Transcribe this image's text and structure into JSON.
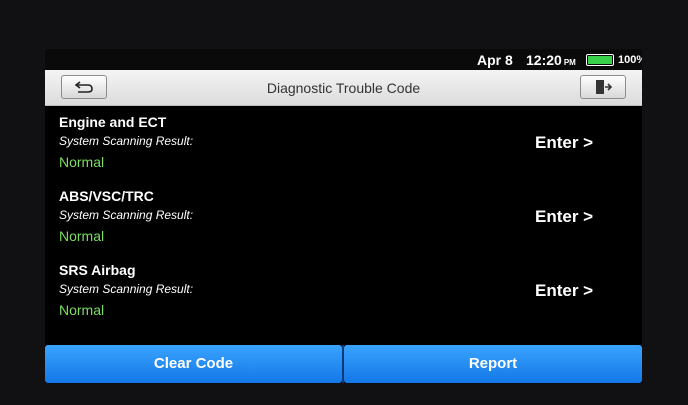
{
  "status": {
    "date": "Apr 8",
    "time": "12:20",
    "ampm": "PM",
    "battery_percent": "100%",
    "battery_level": 1.0,
    "battery_color": "#39d04a"
  },
  "header": {
    "title": "Diagnostic Trouble Code",
    "back_icon": "back-arrow-icon",
    "exit_icon": "exit-door-icon"
  },
  "systems": [
    {
      "name": "Engine and ECT",
      "result_label": "System Scanning Result:",
      "result": "Normal",
      "action": "Enter >"
    },
    {
      "name": "ABS/VSC/TRC",
      "result_label": "System Scanning Result:",
      "result": "Normal",
      "action": "Enter >"
    },
    {
      "name": "SRS Airbag",
      "result_label": "System Scanning Result:",
      "result": "Normal",
      "action": "Enter >"
    }
  ],
  "footer": {
    "clear_label": "Clear Code",
    "report_label": "Report"
  },
  "colors": {
    "normal_status": "#7cdd62",
    "button_blue": "#1f8cf5"
  }
}
